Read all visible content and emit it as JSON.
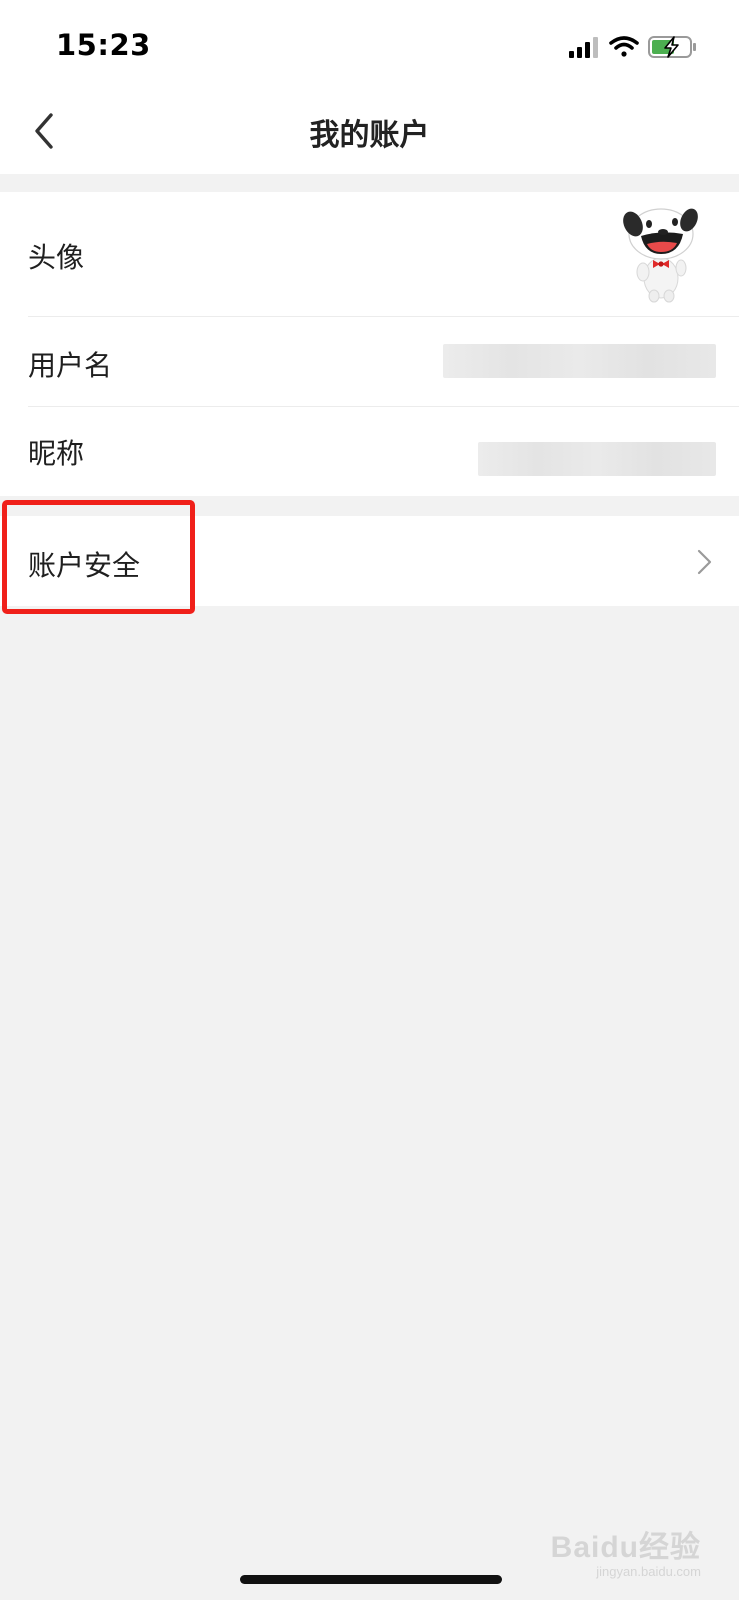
{
  "status_bar": {
    "time": "15:23",
    "icons": [
      "signal-icon",
      "wifi-icon",
      "battery-charging-icon"
    ],
    "battery_color": "#4caf50"
  },
  "nav": {
    "title": "我的账户",
    "back_icon": "chevron-left-icon"
  },
  "account": {
    "rows": [
      {
        "label": "头像",
        "value": "avatar-image"
      },
      {
        "label": "用户名",
        "value": ""
      },
      {
        "label": "昵称",
        "value": ""
      }
    ]
  },
  "security": {
    "label": "账户安全",
    "chevron_icon": "chevron-right-icon"
  },
  "highlight_color": "#f0201a",
  "watermark": {
    "logo": "Baidu经验",
    "url": "jingyan.baidu.com"
  }
}
